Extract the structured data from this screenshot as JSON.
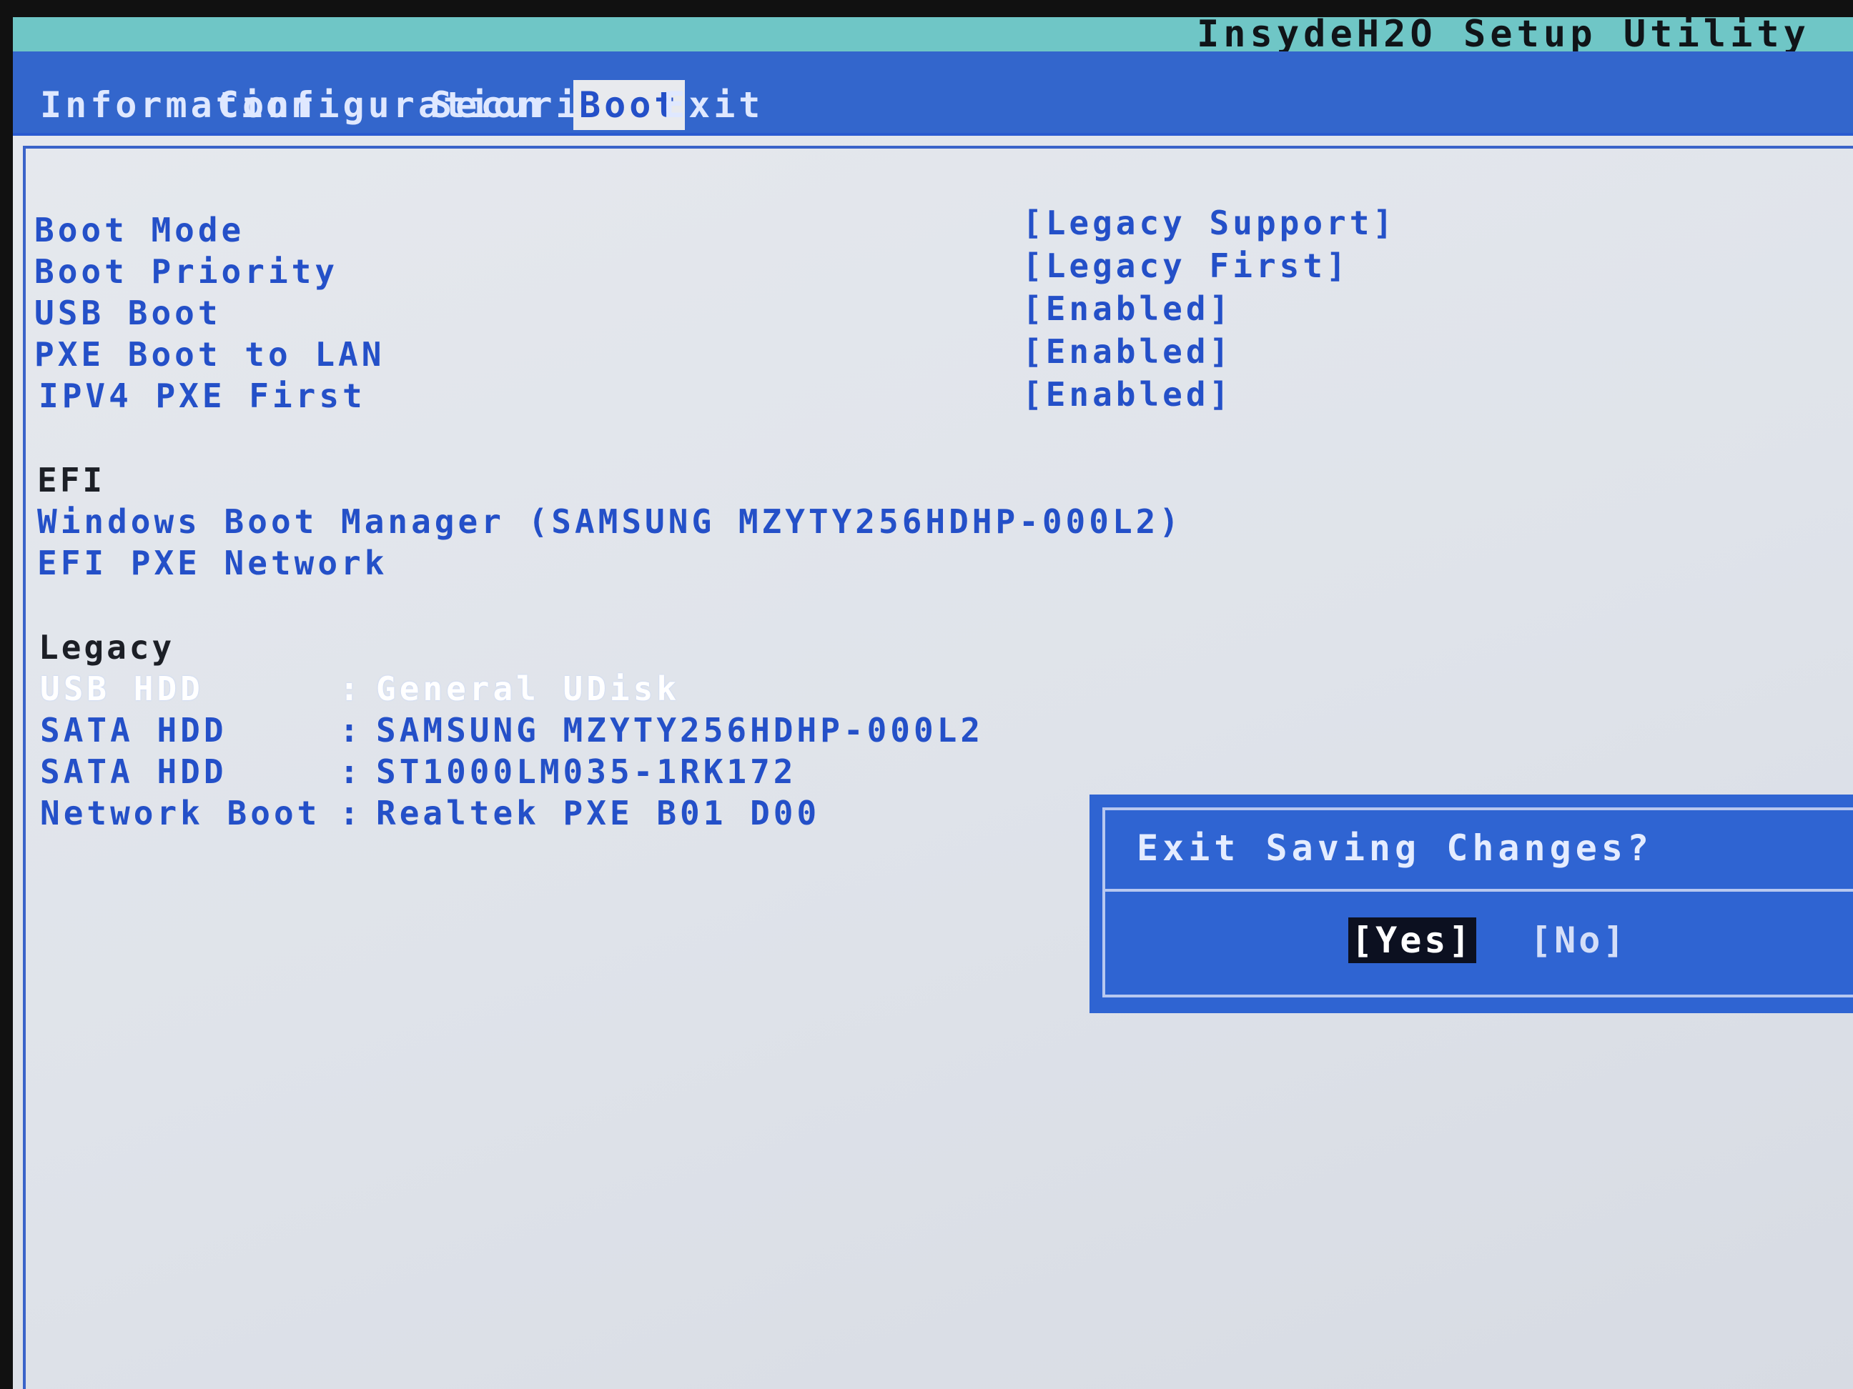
{
  "app": {
    "title": "InsydeH2O Setup Utility"
  },
  "menu": {
    "tabs": [
      {
        "label": "Information"
      },
      {
        "label": "Configuration"
      },
      {
        "label": "Security"
      },
      {
        "label": "Boot",
        "active": true
      },
      {
        "label": "Exit"
      }
    ]
  },
  "settings": [
    {
      "label": "Boot Mode",
      "value": "[Legacy Support]"
    },
    {
      "label": "Boot Priority",
      "value": "[Legacy First]"
    },
    {
      "label": "USB Boot",
      "value": "[Enabled]"
    },
    {
      "label": "PXE Boot to LAN",
      "value": "[Enabled]"
    },
    {
      "label": "IPV4 PXE First",
      "value": "[Enabled]"
    }
  ],
  "efi": {
    "heading": "EFI",
    "items": [
      "Windows Boot Manager (SAMSUNG MZYTY256HDHP-000L2)",
      "EFI PXE Network"
    ]
  },
  "legacy": {
    "heading": "Legacy",
    "items": [
      {
        "type": "USB HDD",
        "sep": ":",
        "device": "General UDisk",
        "selected": true
      },
      {
        "type": "SATA HDD",
        "sep": ":",
        "device": "SAMSUNG MZYTY256HDHP-000L2"
      },
      {
        "type": "SATA HDD",
        "sep": ":",
        "device": "ST1000LM035-1RK172"
      },
      {
        "type": "Network Boot",
        "sep": ":",
        "device": "Realtek PXE B01 D00"
      }
    ]
  },
  "dialog": {
    "title": "Exit Saving Changes?",
    "yes": "[Yes]",
    "no": "[No]"
  },
  "colors": {
    "menu_bar": "#3366cc",
    "title_bar": "#6fc6c6",
    "text_blue": "#2450c8",
    "dialog": "#2f64d2"
  }
}
